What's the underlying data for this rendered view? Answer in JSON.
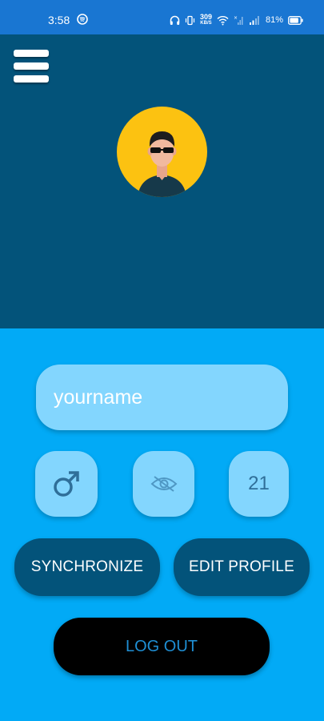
{
  "status_bar": {
    "time": "3:58",
    "net_speed_value": "309",
    "net_speed_unit": "KB/S",
    "battery_percent": "81%"
  },
  "profile": {
    "name_placeholder": "yourname",
    "gender_icon": "male-symbol-icon",
    "visibility_icon": "eye-off-icon",
    "age": "21"
  },
  "actions": {
    "synchronize_label": "SYNCHRONIZE",
    "edit_profile_label": "EDIT PROFILE",
    "logout_label": "LOG OUT"
  },
  "colors": {
    "status_bar": "#1976d2",
    "header_bg": "#03537a",
    "body_bg": "#02aaf6",
    "field_bg": "#83d6fe",
    "avatar_bg": "#fcc211",
    "logout_text": "#1f8fd4"
  }
}
